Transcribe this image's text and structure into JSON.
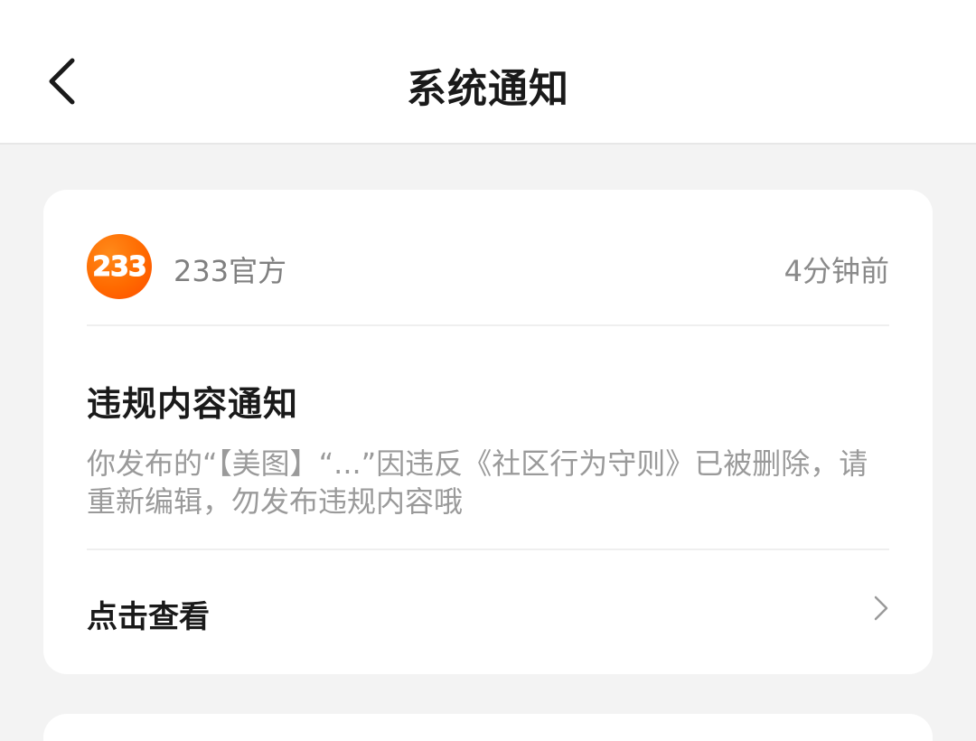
{
  "header": {
    "title": "系统通知"
  },
  "notification": {
    "avatar_text": "233",
    "sender": "233官方",
    "time": "4分钟前",
    "title": "违规内容通知",
    "body": "你发布的“【美图】“...”因违反《社区行为守则》已被删除，请重新编辑，勿发布违规内容哦",
    "action_label": "点击查看"
  },
  "colors": {
    "page_background": "#f3f3f3",
    "card_background": "#ffffff",
    "avatar_orange": "#ff6a00",
    "title_text": "#1a1a1a",
    "secondary_text": "#9a9a9a"
  },
  "icons": {
    "back": "chevron-left-icon",
    "action": "chevron-right-icon"
  }
}
